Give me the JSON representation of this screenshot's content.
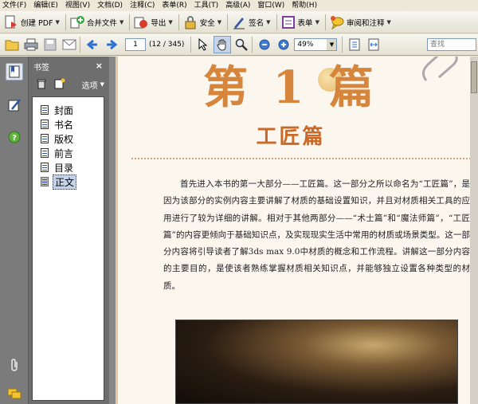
{
  "menu": [
    "文件(F)",
    "编辑(E)",
    "视图(V)",
    "文档(D)",
    "注释(C)",
    "表单(R)",
    "工具(T)",
    "高级(A)",
    "窗口(W)",
    "帮助(H)"
  ],
  "toolbar": {
    "create_pdf": "创建 PDF",
    "combine": "合并文件",
    "export": "导出",
    "security": "安全",
    "sign": "签名",
    "forms": "表单",
    "review": "审阅和注释"
  },
  "nav": {
    "page_number": "1",
    "page_count": "(12 / 345)",
    "zoom": "49%",
    "find_placeholder": "查找"
  },
  "panel": {
    "title": "书签",
    "close": "×",
    "options": "选项",
    "bookmarks": [
      {
        "label": "封面"
      },
      {
        "label": "书名"
      },
      {
        "label": "版权"
      },
      {
        "label": "前言"
      },
      {
        "label": "目录"
      },
      {
        "label": "正文"
      }
    ]
  },
  "document": {
    "heading": "第 1 篇",
    "subheading": "工匠篇",
    "paragraph": "首先进入本书的第一大部分——工匠篇。这一部分之所以命名为“工匠篇”，是因为该部分的实例内容主要讲解了材质的基础设置知识，并且对材质相关工具的应用进行了较为详细的讲解。相对于其他两部分——“术士篇”和“魔法师篇”，“工匠篇”的内容更倾向于基础知识点，及实现现实生活中常用的材质或场景类型。这一部分内容将引导读者了解3ds max 9.0中材质的概念和工作流程。讲解这一部分内容的主要目的，是使该者熟练掌握材质相关知识点，并能够独立设置各种类型的材质。"
  }
}
